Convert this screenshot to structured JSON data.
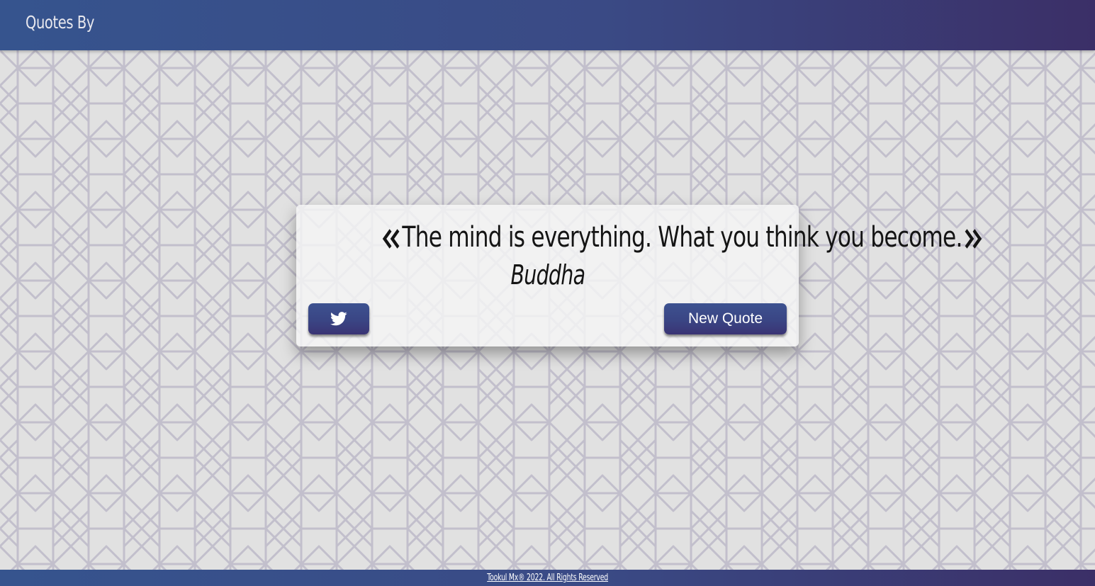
{
  "navbar": {
    "brand": "Quotes By"
  },
  "quote": {
    "text": "The mind is everything. What you think you become.",
    "author": "Buddha",
    "open_icon": "double-chevron-left-icon",
    "close_icon": "double-chevron-right-icon"
  },
  "actions": {
    "tweet_icon": "twitter-icon",
    "new_quote_label": "New Quote"
  },
  "footer": {
    "text": "Tookul Mx® 2022. All Rights Reserved"
  },
  "colors": {
    "primary": "#3a4a85",
    "primary_dark": "#3b2f67",
    "background": "#e1e1e1",
    "pattern_stroke": "#c2bfcc"
  }
}
